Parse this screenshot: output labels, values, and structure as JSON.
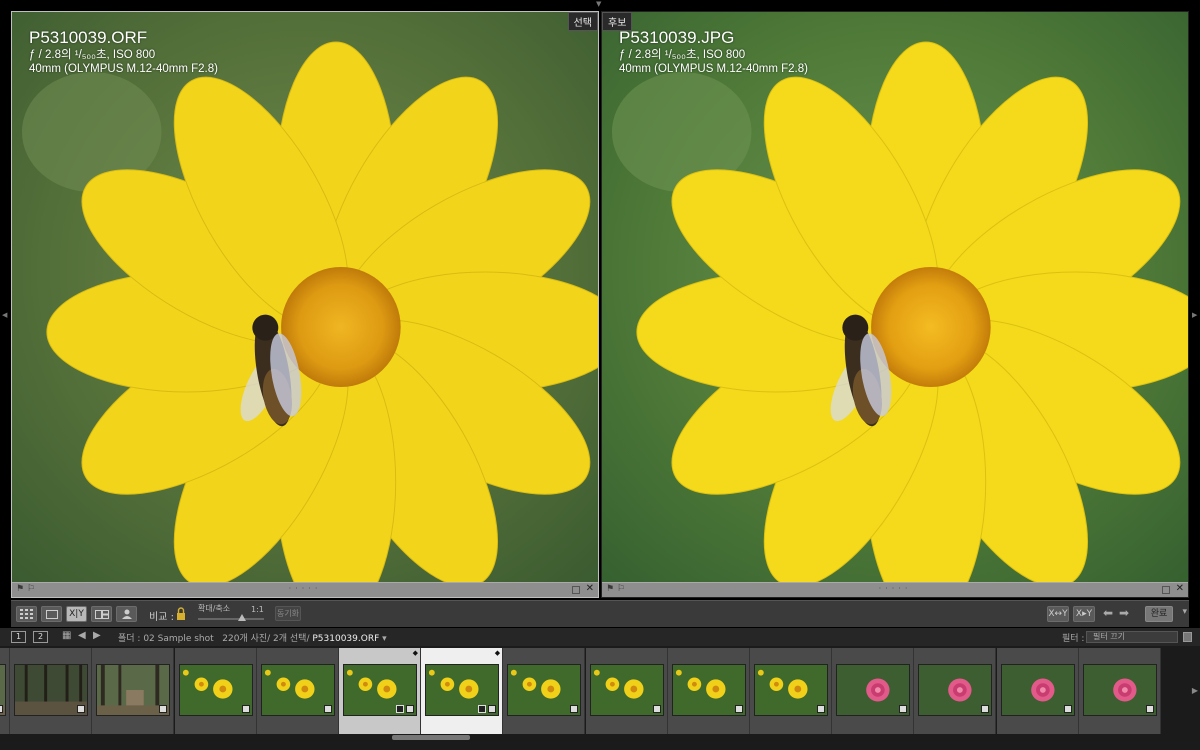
{
  "compare": {
    "select": {
      "tag": "선택",
      "filename": "P5310039.ORF",
      "exposure": "ƒ / 2.8의 ¹/₅₀₀초, ISO 800",
      "lens": "40mm (OLYMPUS M.12-40mm F2.8)"
    },
    "candidate": {
      "tag": "후보",
      "filename": "P5310039.JPG",
      "exposure": "ƒ / 2.8의 ¹/₅₀₀초, ISO 800",
      "lens": "40mm (OLYMPUS M.12-40mm F2.8)"
    }
  },
  "toolbar": {
    "compare_label": "비교 :",
    "zoom_label": "확대/축소",
    "zoom_value": "1:1",
    "sync_button": "동기화",
    "swap_button": "X↔Y",
    "make_select_button": "X▸Y",
    "done_button": "완료",
    "view_icons": [
      "grid-icon",
      "loupe-icon",
      "compare-icon",
      "survey-icon",
      "people-icon"
    ],
    "xy_label": "X|Y"
  },
  "filmstrip_header": {
    "monitor1": "1",
    "monitor2": "2",
    "folder_path": "폴더 : 02 Sample shot",
    "count": "220개 사진/ 2개 선택/",
    "current": "P5310039.ORF",
    "filter_label": "필터 :",
    "filter_value": "필터 끄기"
  },
  "filmstrip": {
    "thumbs": [
      {
        "subject": "forest-cabin"
      },
      {
        "subject": "forest-path"
      },
      {
        "subject": "forest-cabin"
      },
      {
        "subject": "yellow-flowers"
      },
      {
        "subject": "yellow-flowers"
      },
      {
        "subject": "yellow-flowers",
        "selected": true
      },
      {
        "subject": "yellow-flowers",
        "selected": true,
        "active": true
      },
      {
        "subject": "yellow-flowers"
      },
      {
        "subject": "yellow-flowers"
      },
      {
        "subject": "yellow-flowers"
      },
      {
        "subject": "yellow-flowers"
      },
      {
        "subject": "pink-rose"
      },
      {
        "subject": "pink-rose"
      },
      {
        "subject": "pink-rose"
      },
      {
        "subject": "pink-rose"
      }
    ]
  },
  "colors": {
    "panel_bg": "#3a3a3a",
    "flower_yellow": "#f2d51a",
    "flower_center": "#e6a314",
    "bokeh_green": "#5a7a3a"
  }
}
